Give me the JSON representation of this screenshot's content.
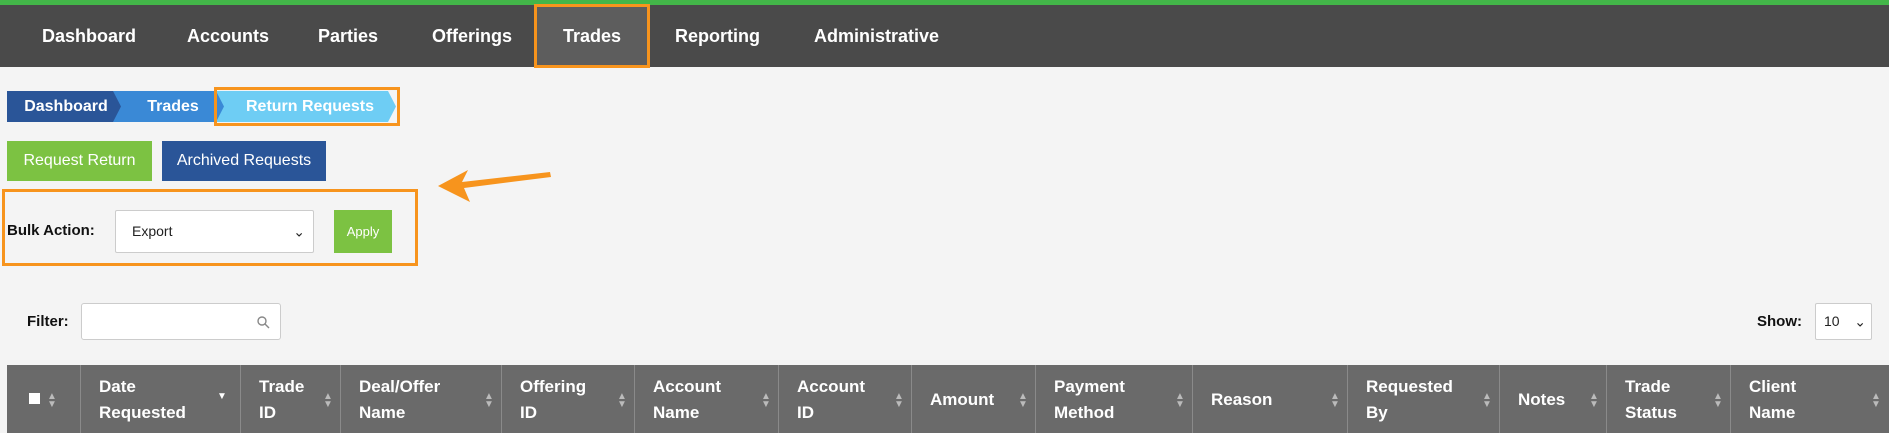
{
  "nav": {
    "items": [
      "Dashboard",
      "Accounts",
      "Parties",
      "Offerings",
      "Trades",
      "Reporting",
      "Administrative"
    ]
  },
  "breadcrumb": [
    "Dashboard",
    "Trades",
    "Return Requests"
  ],
  "actions": {
    "request_return": "Request Return",
    "archived_requests": "Archived Requests"
  },
  "bulk": {
    "label": "Bulk Action:",
    "selected": "Export",
    "apply": "Apply"
  },
  "filter": {
    "label": "Filter:",
    "value": ""
  },
  "show": {
    "label": "Show:",
    "selected": "10"
  },
  "table": {
    "headers": [
      "Date Requested",
      "Trade ID",
      "Deal/Offer Name",
      "Offering ID",
      "Account Name",
      "Account ID",
      "Amount",
      "Payment Method",
      "Reason",
      "Requested By",
      "Notes",
      "Trade Status",
      "Client Name"
    ]
  },
  "colors": {
    "accent_orange": "#f7941d",
    "green": "#7cc242",
    "blue": "#2a5598"
  }
}
